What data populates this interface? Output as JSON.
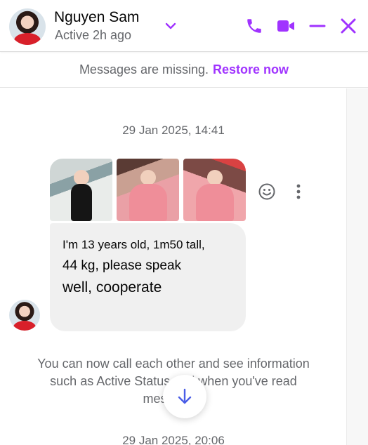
{
  "header": {
    "name": "Nguyen Sam",
    "status": "Active 2h ago",
    "accent": "#a033ff",
    "icons": [
      "chevron-down-icon",
      "phone-icon",
      "video-icon",
      "minimize-icon",
      "close-icon"
    ]
  },
  "banner": {
    "text": "Messages are missing.",
    "action": "Restore now"
  },
  "conversation": {
    "timestamp_1": "29 Jan 2025, 14:41",
    "message": {
      "photos": [
        "photo-1",
        "photo-2",
        "photo-3"
      ],
      "line1": "I'm 13 years old, 1m50 tall,",
      "line2": "44 kg, please speak",
      "line3": "well, cooperate",
      "actions": [
        "emoji-icon",
        "more-options-icon"
      ]
    },
    "info_text": "You can now call each other and see information such as Active Status and when you've read messages.",
    "timestamp_2": "29 Jan 2025, 20:06"
  }
}
